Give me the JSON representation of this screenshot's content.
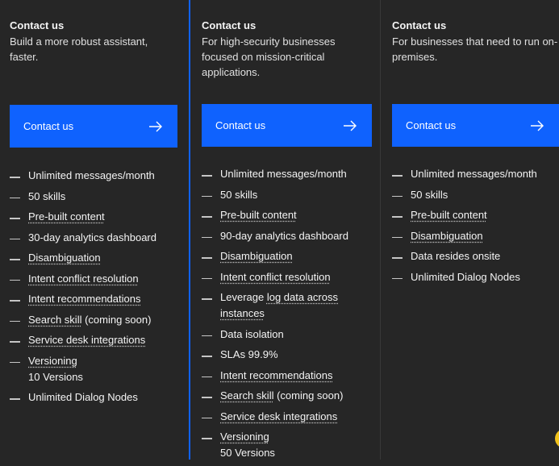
{
  "plans": [
    {
      "title": "Contact us",
      "description": "Build a more robust assistant, faster.",
      "cta_label": "Contact us",
      "features": [
        {
          "text": "Unlimited messages/month",
          "link": "",
          "suffix": "",
          "sub": ""
        },
        {
          "text": "50 skills",
          "link": "",
          "suffix": "",
          "sub": ""
        },
        {
          "text": "",
          "link": "Pre-built content",
          "suffix": "",
          "sub": ""
        },
        {
          "text": "30-day analytics dashboard",
          "link": "",
          "suffix": "",
          "sub": ""
        },
        {
          "text": "",
          "link": "Disambiguation",
          "suffix": "",
          "sub": ""
        },
        {
          "text": "",
          "link": "Intent conflict resolution",
          "suffix": "",
          "sub": ""
        },
        {
          "text": "",
          "link": "Intent recommendations",
          "suffix": "",
          "sub": ""
        },
        {
          "text": "",
          "link": "Search skill",
          "suffix": " (coming soon)",
          "sub": ""
        },
        {
          "text": "",
          "link": "Service desk integrations",
          "suffix": "",
          "sub": ""
        },
        {
          "text": "",
          "link": "Versioning",
          "suffix": "",
          "sub": "10 Versions"
        },
        {
          "text": "Unlimited Dialog Nodes",
          "link": "",
          "suffix": "",
          "sub": ""
        }
      ]
    },
    {
      "title": "Contact us",
      "description": "For high-security businesses focused on mission-critical applications.",
      "cta_label": "Contact us",
      "features": [
        {
          "text": "Unlimited messages/month",
          "link": "",
          "suffix": "",
          "sub": ""
        },
        {
          "text": "50 skills",
          "link": "",
          "suffix": "",
          "sub": ""
        },
        {
          "text": "",
          "link": "Pre-built content",
          "suffix": "",
          "sub": ""
        },
        {
          "text": "90-day analytics dashboard",
          "link": "",
          "suffix": "",
          "sub": ""
        },
        {
          "text": "",
          "link": "Disambiguation",
          "suffix": "",
          "sub": ""
        },
        {
          "text": "",
          "link": "Intent conflict resolution",
          "suffix": "",
          "sub": ""
        },
        {
          "text": "Leverage ",
          "link": "log data across instances",
          "suffix": "",
          "sub": ""
        },
        {
          "text": "Data isolation",
          "link": "",
          "suffix": "",
          "sub": ""
        },
        {
          "text": "SLAs 99.9%",
          "link": "",
          "suffix": "",
          "sub": ""
        },
        {
          "text": "",
          "link": "Intent recommendations",
          "suffix": "",
          "sub": ""
        },
        {
          "text": "",
          "link": "Search skill",
          "suffix": " (coming soon)",
          "sub": ""
        },
        {
          "text": "",
          "link": "Service desk integrations",
          "suffix": "",
          "sub": ""
        },
        {
          "text": "",
          "link": "Versioning",
          "suffix": "",
          "sub": "50 Versions"
        }
      ]
    },
    {
      "title": "Contact us",
      "description": "For businesses that need to run on-premises.",
      "cta_label": "Contact us",
      "features": [
        {
          "text": "Unlimited messages/month",
          "link": "",
          "suffix": "",
          "sub": ""
        },
        {
          "text": "50 skills",
          "link": "",
          "suffix": "",
          "sub": ""
        },
        {
          "text": "",
          "link": "Pre-built content",
          "suffix": "",
          "sub": ""
        },
        {
          "text": "",
          "link": "Disambiguation",
          "suffix": "",
          "sub": ""
        },
        {
          "text": "Data resides onsite",
          "link": "",
          "suffix": "",
          "sub": ""
        },
        {
          "text": "Unlimited Dialog Nodes",
          "link": "",
          "suffix": "",
          "sub": ""
        }
      ]
    }
  ],
  "icons": {
    "cta": "arrow-right-icon",
    "bullet": "dash-icon",
    "help": "help-bubble-icon"
  },
  "colors": {
    "background": "#262626",
    "accent": "#0f62fe",
    "help": "#f1c21b"
  }
}
